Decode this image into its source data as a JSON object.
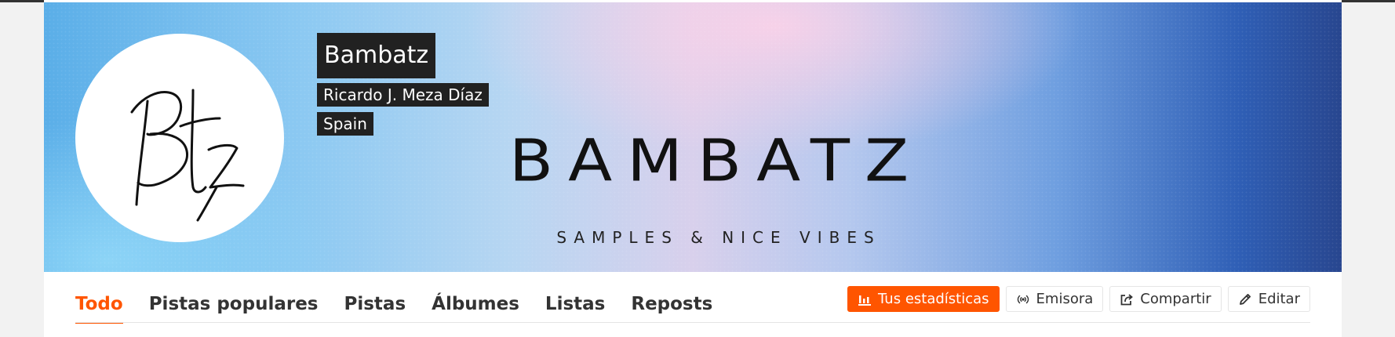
{
  "profile": {
    "username": "Bambatz",
    "real_name": "Ricardo J. Meza Díaz",
    "location": "Spain"
  },
  "banner": {
    "title": "BAMBATZ",
    "subtitle": "SAMPLES & NICE VIBES"
  },
  "tabs": [
    {
      "label": "Todo",
      "active": true
    },
    {
      "label": "Pistas populares",
      "active": false
    },
    {
      "label": "Pistas",
      "active": false
    },
    {
      "label": "Álbumes",
      "active": false
    },
    {
      "label": "Listas",
      "active": false
    },
    {
      "label": "Reposts",
      "active": false
    }
  ],
  "actions": {
    "stats": {
      "label": "Tus estadísticas",
      "icon": "bar-chart-icon"
    },
    "station": {
      "label": "Emisora",
      "icon": "broadcast-icon"
    },
    "share": {
      "label": "Compartir",
      "icon": "share-icon"
    },
    "edit": {
      "label": "Editar",
      "icon": "pencil-icon"
    }
  },
  "colors": {
    "accent": "#ff5500",
    "badge_bg": "#212121"
  }
}
